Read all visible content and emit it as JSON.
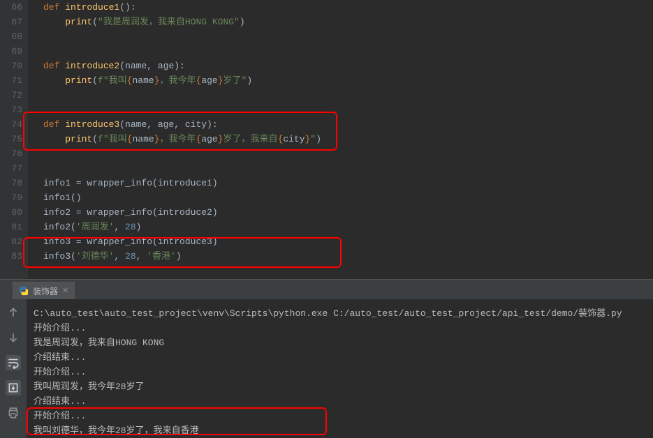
{
  "gutter": [
    "66",
    "67",
    "68",
    "69",
    "70",
    "71",
    "72",
    "73",
    "74",
    "75",
    "76",
    "77",
    "78",
    "79",
    "80",
    "81",
    "82",
    "83"
  ],
  "code": {
    "l66": {
      "def": "def ",
      "fn": "introduce1",
      "p": "():"
    },
    "l67": {
      "fn": "print",
      "prefix": "(",
      "s": "\"我是周润发，我来自HONG KONG\"",
      "suffix": ")"
    },
    "l70": {
      "def": "def ",
      "fn": "introduce2",
      "p": "(name, age):"
    },
    "l71": {
      "fn": "print",
      "prefix": "(",
      "fpre": "f\"我叫",
      "ob": "{",
      "v1": "name",
      "cb": "}",
      "mid": "，我今年",
      "ob2": "{",
      "v2": "age",
      "cb2": "}",
      "suf": "岁了\"",
      "end": ")"
    },
    "l74": {
      "def": "def ",
      "fn": "introduce3",
      "p": "(name, age, city):"
    },
    "l75": {
      "fn": "print",
      "prefix": "(",
      "fpre": "f\"我叫",
      "ob": "{",
      "v1": "name",
      "cb": "}",
      "mid": "，我今年",
      "ob2": "{",
      "v2": "age",
      "cb2": "}",
      "mid2": "岁了，我来自",
      "ob3": "{",
      "v3": "city",
      "cb3": "}",
      "suf": "\"",
      "end": ")"
    },
    "l78": {
      "a": "info1 = ",
      "b": "wrapper_info",
      "c": "(introduce1)"
    },
    "l79": {
      "a": "info1()"
    },
    "l80": {
      "a": "info2 = ",
      "b": "wrapper_info",
      "c": "(introduce2)"
    },
    "l81": {
      "a": "info2(",
      "s": "'周润发'",
      "comma": ", ",
      "n": "28",
      "end": ")"
    },
    "l82": {
      "a": "info3 = ",
      "b": "wrapper_info",
      "c": "(introduce3)"
    },
    "l83": {
      "a": "info3(",
      "s": "'刘德华'",
      "comma": ", ",
      "n": "28",
      "comma2": ", ",
      "s2": "'香港'",
      "end": ")"
    }
  },
  "tab": {
    "label": "装饰器"
  },
  "output": [
    "C:\\auto_test\\auto_test_project\\venv\\Scripts\\python.exe C:/auto_test/auto_test_project/api_test/demo/装饰器.py",
    "开始介绍...",
    "我是周润发，我来自HONG KONG",
    "介绍结束...",
    "开始介绍...",
    "我叫周润发，我今年28岁了",
    "介绍结束...",
    "开始介绍...",
    "我叫刘德华，我今年28岁了，我来自香港"
  ]
}
